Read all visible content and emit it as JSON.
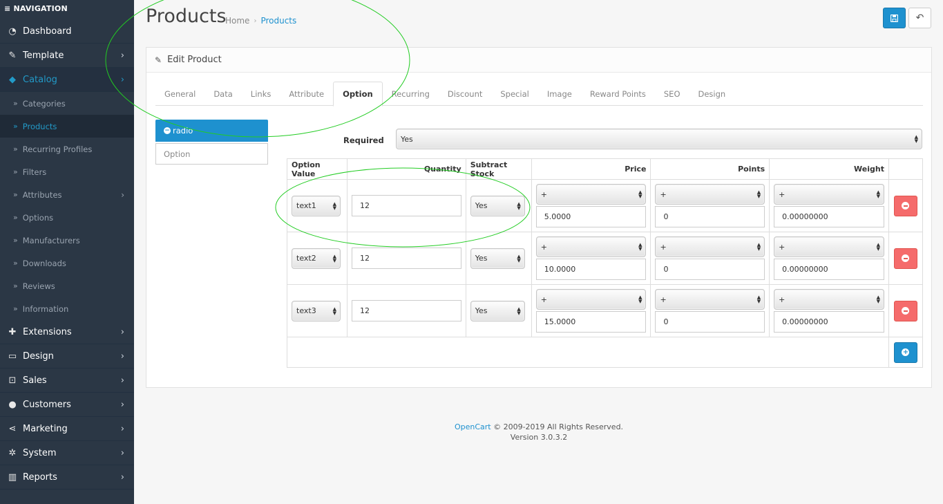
{
  "sidebar": {
    "heading": "NAVIGATION",
    "menu": [
      {
        "label": "Dashboard",
        "icon": "dashboard-icon",
        "glyph": "◔",
        "chevron": false
      },
      {
        "label": "Template",
        "icon": "brush-icon",
        "glyph": "✎",
        "chevron": true
      },
      {
        "label": "Catalog",
        "icon": "tag-icon",
        "glyph": "◆",
        "chevron": true
      }
    ],
    "catalog_sub": [
      {
        "label": "Categories"
      },
      {
        "label": "Products"
      },
      {
        "label": "Recurring Profiles"
      },
      {
        "label": "Filters"
      },
      {
        "label": "Attributes"
      },
      {
        "label": "Options"
      },
      {
        "label": "Manufacturers"
      },
      {
        "label": "Downloads"
      },
      {
        "label": "Reviews"
      },
      {
        "label": "Information"
      }
    ],
    "menu_bottom": [
      {
        "label": "Extensions",
        "icon": "puzzle-icon",
        "glyph": "✚"
      },
      {
        "label": "Design",
        "icon": "monitor-icon",
        "glyph": "▭"
      },
      {
        "label": "Sales",
        "icon": "cart-icon",
        "glyph": "⊡"
      },
      {
        "label": "Customers",
        "icon": "user-icon",
        "glyph": "●"
      },
      {
        "label": "Marketing",
        "icon": "share-icon",
        "glyph": "⋖"
      },
      {
        "label": "System",
        "icon": "cog-icon",
        "glyph": "✲"
      },
      {
        "label": "Reports",
        "icon": "bar-chart-icon",
        "glyph": "▥"
      }
    ]
  },
  "header": {
    "title": "Products",
    "breadcrumb": [
      "Home",
      "Products"
    ]
  },
  "panel": {
    "title": "Edit Product",
    "tabs": [
      "General",
      "Data",
      "Links",
      "Attribute",
      "Option",
      "Recurring",
      "Discount",
      "Special",
      "Image",
      "Reward Points",
      "SEO",
      "Design"
    ],
    "active_tab": "Option"
  },
  "option_list": {
    "selected": "radio",
    "input_placeholder": "Option"
  },
  "required": {
    "label": "Required",
    "value": "Yes"
  },
  "table": {
    "headers": [
      "Option Value",
      "Quantity",
      "Subtract Stock",
      "Price",
      "Points",
      "Weight"
    ],
    "rows": [
      {
        "option_value": "text1",
        "quantity": "12",
        "subtract": "Yes",
        "price_prefix": "+",
        "price": "5.0000",
        "points_prefix": "+",
        "points": "0",
        "weight_prefix": "+",
        "weight": "0.00000000"
      },
      {
        "option_value": "text2",
        "quantity": "12",
        "subtract": "Yes",
        "price_prefix": "+",
        "price": "10.0000",
        "points_prefix": "+",
        "points": "0",
        "weight_prefix": "+",
        "weight": "0.00000000"
      },
      {
        "option_value": "text3",
        "quantity": "12",
        "subtract": "Yes",
        "price_prefix": "+",
        "price": "15.0000",
        "points_prefix": "+",
        "points": "0",
        "weight_prefix": "+",
        "weight": "0.00000000"
      }
    ]
  },
  "footer": {
    "brand": "OpenCart",
    "copyright": "© 2009-2019 All Rights Reserved.",
    "version": "Version 3.0.3.2"
  },
  "colors": {
    "sidebar_bg": "#2b3745",
    "accent": "#1e91cf",
    "danger": "#f56b6b",
    "annotation": "#22cc22"
  }
}
